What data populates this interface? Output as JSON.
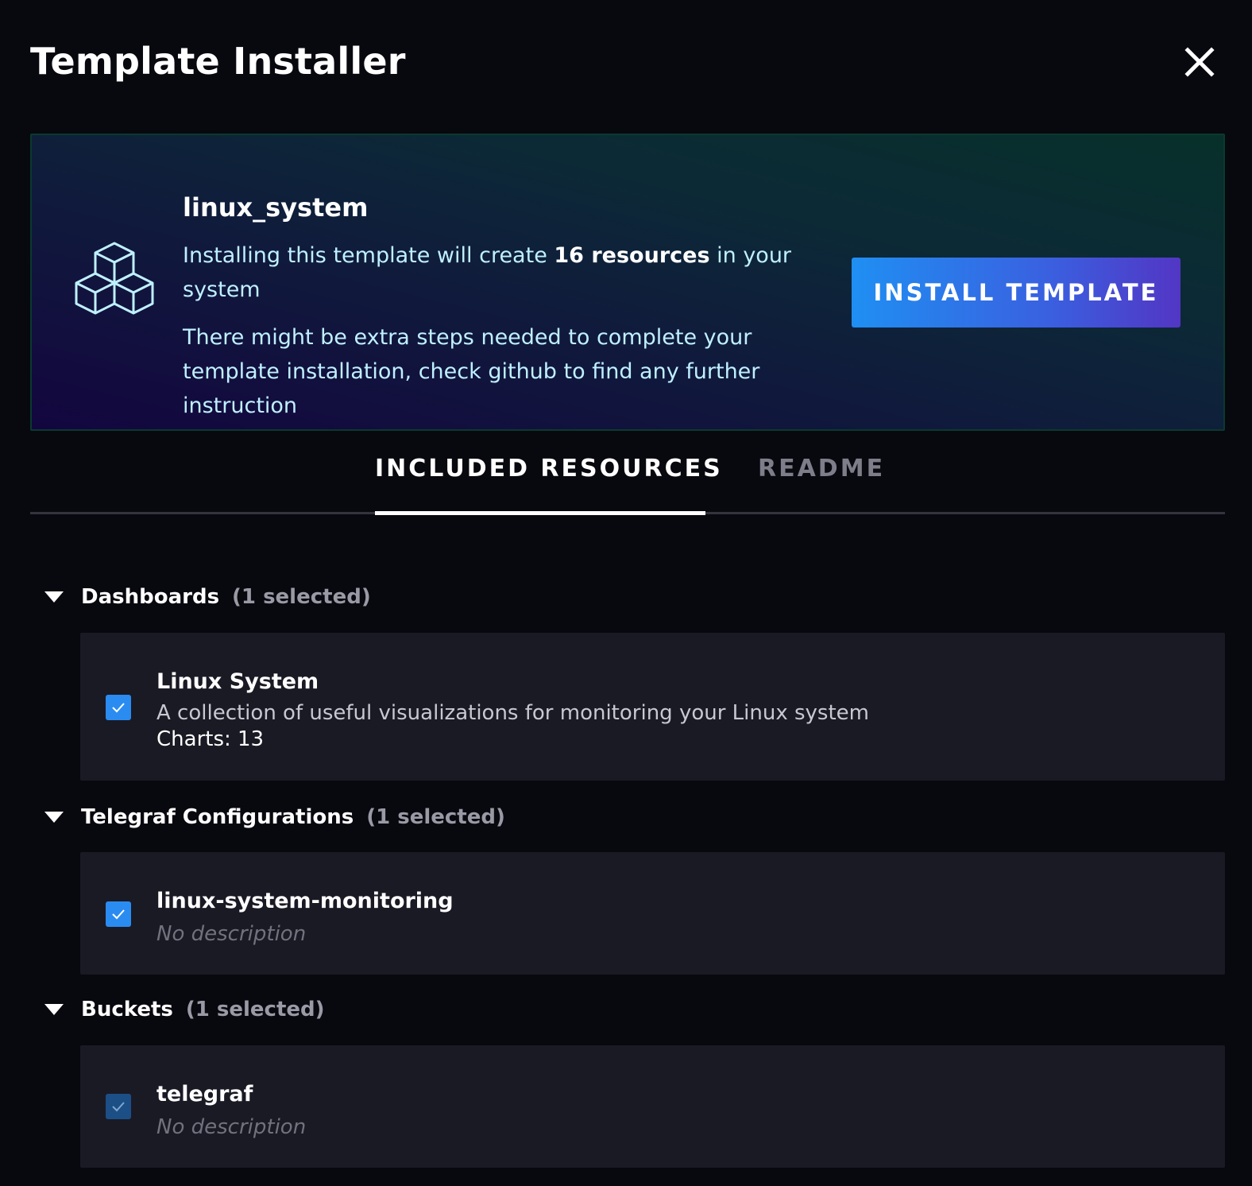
{
  "header": {
    "title": "Template Installer",
    "close_icon": "close-icon"
  },
  "banner": {
    "template_name": "linux_system",
    "icon": "cubes-icon",
    "line1_before": "Installing this template will create ",
    "line1_bold": "16 resources",
    "line1_after": " in your system",
    "line2": "There might be extra steps needed to complete your template installation, check github to find any further instruction",
    "install_button": "INSTALL TEMPLATE"
  },
  "tabs": [
    {
      "label": "INCLUDED RESOURCES",
      "active": true
    },
    {
      "label": "README",
      "active": false
    }
  ],
  "sections": [
    {
      "title": "Dashboards",
      "count": "(1 selected)",
      "items": [
        {
          "title": "Linux System",
          "description": "A collection of useful visualizations for monitoring your Linux system",
          "meta": "Charts: 13",
          "checked": true
        }
      ]
    },
    {
      "title": "Telegraf Configurations",
      "count": "(1 selected)",
      "items": [
        {
          "title": "linux-system-monitoring",
          "description": "No description",
          "checked": true
        }
      ]
    },
    {
      "title": "Buckets",
      "count": "(1 selected)",
      "items": [
        {
          "title": "telegraf",
          "description": "No description",
          "checked": true
        }
      ]
    }
  ],
  "colors": {
    "background": "#08080f",
    "accent": "#2a8cf0",
    "banner_text": "#bff0ff",
    "card": "#1a1a25"
  }
}
